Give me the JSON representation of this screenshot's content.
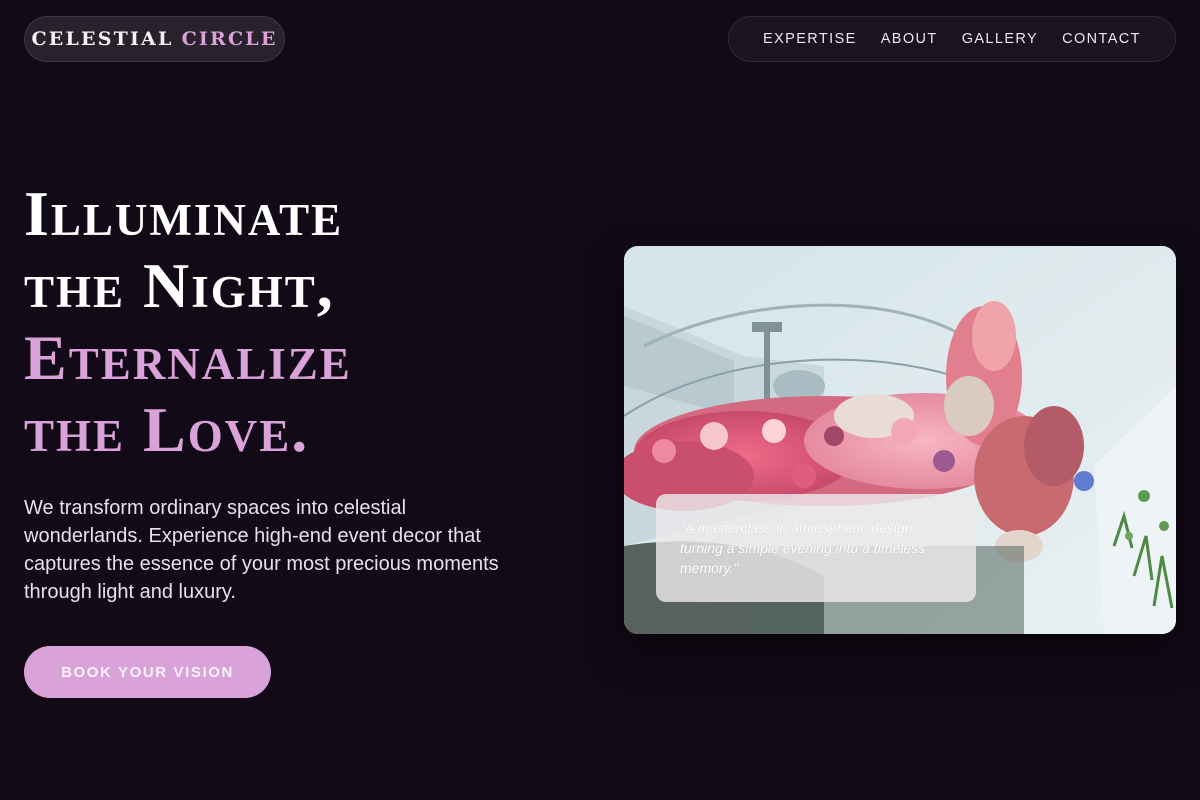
{
  "header": {
    "brand_word1": "CELESTIAL",
    "brand_word2": "CIRCLE",
    "nav": [
      "EXPERTISE",
      "ABOUT",
      "GALLERY",
      "CONTACT"
    ]
  },
  "hero": {
    "headline_line1": "Illuminate",
    "headline_line2": "the Night,",
    "headline_line3": "Eternalize",
    "headline_line4": "the Love.",
    "lede": "We transform ordinary spaces into celestial wonderlands. Experience high-end event decor that captures the essence of your most precious moments through light and luxury.",
    "cta_label": "BOOK YOUR VISION"
  },
  "feature_card": {
    "quote": "\"A masterclass in atmospheric design, turning a simple evening into a timeless memory.\""
  },
  "colors": {
    "background": "#130a18",
    "accent": "#d9a2d9",
    "text": "#f3eef5"
  }
}
